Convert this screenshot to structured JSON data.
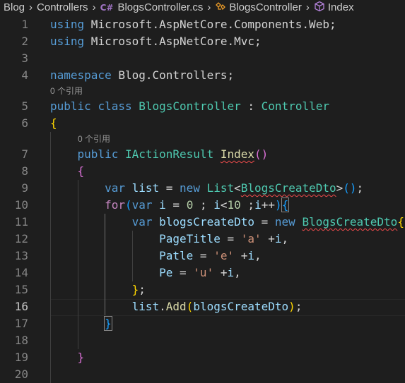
{
  "breadcrumb": {
    "items": [
      "Blog",
      "Controllers",
      "BlogsController.cs",
      "BlogsController",
      "Index"
    ],
    "file_icon_text": "C#"
  },
  "editor": {
    "lines": [
      {
        "num": "1",
        "tokens": [
          {
            "t": "using",
            "c": "kw"
          },
          {
            "t": " Microsoft.AspNetCore.Components.Web;",
            "c": "ns"
          }
        ]
      },
      {
        "num": "2",
        "tokens": [
          {
            "t": "using",
            "c": "kw"
          },
          {
            "t": " Microsoft.AspNetCore.Mvc;",
            "c": "ns"
          }
        ]
      },
      {
        "num": "3",
        "tokens": []
      },
      {
        "num": "4",
        "tokens": [
          {
            "t": "namespace",
            "c": "kw"
          },
          {
            "t": " Blog.Controllers;",
            "c": "ns"
          }
        ]
      },
      {
        "num": "5",
        "tokens": [
          {
            "t": "public",
            "c": "kw"
          },
          {
            "t": " ",
            "c": ""
          },
          {
            "t": "class",
            "c": "kw"
          },
          {
            "t": " ",
            "c": ""
          },
          {
            "t": "BlogsController",
            "c": "typ"
          },
          {
            "t": " : ",
            "c": ""
          },
          {
            "t": "Controller",
            "c": "typ"
          }
        ]
      },
      {
        "num": "6",
        "tokens": [
          {
            "t": "{",
            "c": "b1"
          }
        ]
      },
      {
        "num": "7",
        "tokens": [
          {
            "t": "    ",
            "c": ""
          },
          {
            "t": "public",
            "c": "kw"
          },
          {
            "t": " ",
            "c": ""
          },
          {
            "t": "IActionResult",
            "c": "typ"
          },
          {
            "t": " ",
            "c": ""
          },
          {
            "t": "Index",
            "c": "fn squig"
          },
          {
            "t": "()",
            "c": "b2"
          }
        ]
      },
      {
        "num": "8",
        "tokens": [
          {
            "t": "    ",
            "c": ""
          },
          {
            "t": "{",
            "c": "b2"
          }
        ]
      },
      {
        "num": "9",
        "tokens": [
          {
            "t": "        ",
            "c": ""
          },
          {
            "t": "var",
            "c": "kw"
          },
          {
            "t": " ",
            "c": ""
          },
          {
            "t": "list",
            "c": "var"
          },
          {
            "t": " = ",
            "c": ""
          },
          {
            "t": "new",
            "c": "kw"
          },
          {
            "t": " ",
            "c": ""
          },
          {
            "t": "List",
            "c": "typ"
          },
          {
            "t": "<",
            "c": ""
          },
          {
            "t": "BlogsCreateDto",
            "c": "typ squig"
          },
          {
            "t": ">",
            "c": ""
          },
          {
            "t": "()",
            "c": "b3"
          },
          {
            "t": ";",
            "c": ""
          }
        ]
      },
      {
        "num": "10",
        "tokens": [
          {
            "t": "        ",
            "c": ""
          },
          {
            "t": "for",
            "c": "ctl"
          },
          {
            "t": "(",
            "c": "b3"
          },
          {
            "t": "var",
            "c": "kw"
          },
          {
            "t": " ",
            "c": ""
          },
          {
            "t": "i",
            "c": "var"
          },
          {
            "t": " = ",
            "c": ""
          },
          {
            "t": "0",
            "c": "num"
          },
          {
            "t": " ; ",
            "c": ""
          },
          {
            "t": "i",
            "c": "var"
          },
          {
            "t": "<",
            "c": ""
          },
          {
            "t": "10",
            "c": "num"
          },
          {
            "t": " ;",
            "c": ""
          },
          {
            "t": "i",
            "c": "var"
          },
          {
            "t": "++",
            "c": ""
          },
          {
            "t": ")",
            "c": "b3"
          },
          {
            "t": "{",
            "c": "b3 brmatch"
          }
        ]
      },
      {
        "num": "11",
        "tokens": [
          {
            "t": "            ",
            "c": ""
          },
          {
            "t": "var",
            "c": "kw"
          },
          {
            "t": " ",
            "c": ""
          },
          {
            "t": "blogsCreateDto",
            "c": "var"
          },
          {
            "t": " = ",
            "c": ""
          },
          {
            "t": "new",
            "c": "kw"
          },
          {
            "t": " ",
            "c": ""
          },
          {
            "t": "BlogsCreateDto",
            "c": "typ squig"
          },
          {
            "t": "{",
            "c": "b1"
          }
        ]
      },
      {
        "num": "12",
        "tokens": [
          {
            "t": "                ",
            "c": ""
          },
          {
            "t": "PageTitle",
            "c": "var"
          },
          {
            "t": " = ",
            "c": ""
          },
          {
            "t": "'a'",
            "c": "str"
          },
          {
            "t": " +",
            "c": ""
          },
          {
            "t": "i",
            "c": "var"
          },
          {
            "t": ",",
            "c": ""
          }
        ]
      },
      {
        "num": "13",
        "tokens": [
          {
            "t": "                ",
            "c": ""
          },
          {
            "t": "Patle",
            "c": "var"
          },
          {
            "t": " = ",
            "c": ""
          },
          {
            "t": "'e'",
            "c": "str"
          },
          {
            "t": " +",
            "c": ""
          },
          {
            "t": "i",
            "c": "var"
          },
          {
            "t": ",",
            "c": ""
          }
        ]
      },
      {
        "num": "14",
        "tokens": [
          {
            "t": "                ",
            "c": ""
          },
          {
            "t": "Pe",
            "c": "var"
          },
          {
            "t": " = ",
            "c": ""
          },
          {
            "t": "'u'",
            "c": "str"
          },
          {
            "t": " +",
            "c": ""
          },
          {
            "t": "i",
            "c": "var"
          },
          {
            "t": ",",
            "c": ""
          }
        ]
      },
      {
        "num": "15",
        "tokens": [
          {
            "t": "            ",
            "c": ""
          },
          {
            "t": "}",
            "c": "b1"
          },
          {
            "t": ";",
            "c": ""
          }
        ]
      },
      {
        "num": "16",
        "tokens": [
          {
            "t": "            ",
            "c": ""
          },
          {
            "t": "list",
            "c": "var"
          },
          {
            "t": ".",
            "c": ""
          },
          {
            "t": "Add",
            "c": "fn"
          },
          {
            "t": "(",
            "c": "b1"
          },
          {
            "t": "blogsCreateDto",
            "c": "var"
          },
          {
            "t": ")",
            "c": "b1"
          },
          {
            "t": ";",
            "c": ""
          }
        ]
      },
      {
        "num": "17",
        "tokens": [
          {
            "t": "        ",
            "c": ""
          },
          {
            "t": "}",
            "c": "b3 brmatch"
          }
        ]
      },
      {
        "num": "18",
        "tokens": []
      },
      {
        "num": "19",
        "tokens": [
          {
            "t": "    ",
            "c": ""
          },
          {
            "t": "}",
            "c": "b2"
          }
        ]
      },
      {
        "num": "20",
        "tokens": []
      }
    ],
    "active_line": "16",
    "codelens": [
      {
        "after_line": "4",
        "text": "0 个引用"
      },
      {
        "after_line": "6",
        "text": "0 个引用"
      }
    ]
  }
}
